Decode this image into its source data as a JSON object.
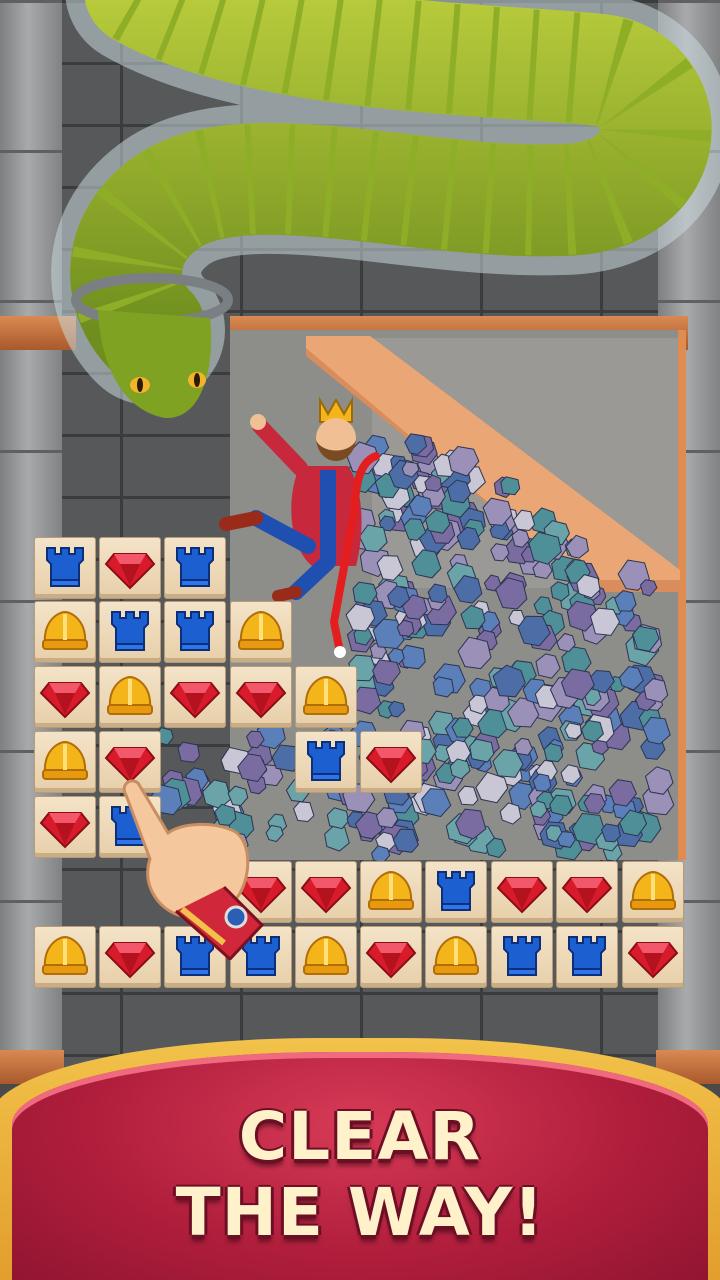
{
  "banner": {
    "line1": "CLEAR",
    "line2": "THE WAY!"
  },
  "colors": {
    "banner_red": "#b01e3c",
    "banner_gold": "#f2c24a",
    "text_cream": "#fff1c9",
    "tile_bg": "#f1ddbf",
    "gem_red": "#d81b2a",
    "helmet_yellow": "#f3b51a",
    "tower_blue": "#1c5fd1"
  },
  "board": {
    "rows": [
      [
        "tower",
        "gem",
        "tower",
        null,
        null,
        null,
        null,
        null,
        null,
        null
      ],
      [
        "helmet",
        "tower",
        "tower",
        "helmet",
        null,
        null,
        null,
        null,
        null,
        null
      ],
      [
        "gem",
        "helmet",
        "gem",
        "gem",
        "helmet",
        null,
        null,
        null,
        null,
        null
      ],
      [
        "helmet",
        "gem",
        null,
        null,
        "tower",
        "gem",
        null,
        null,
        null,
        null
      ],
      [
        "gem",
        "tower",
        null,
        null,
        null,
        null,
        null,
        null,
        null,
        null
      ],
      [
        null,
        null,
        null,
        "gem",
        "gem",
        "helmet",
        "tower",
        "gem",
        "gem",
        "helmet"
      ],
      [
        "helmet",
        "gem",
        "tower",
        "tower",
        "helmet",
        "gem",
        "helmet",
        "tower",
        "tower",
        "gem"
      ]
    ]
  },
  "icons": {
    "tower": "blue-tower-icon",
    "gem": "red-gem-icon",
    "helmet": "yellow-helmet-icon",
    "hand": "pointing-hand-icon"
  }
}
